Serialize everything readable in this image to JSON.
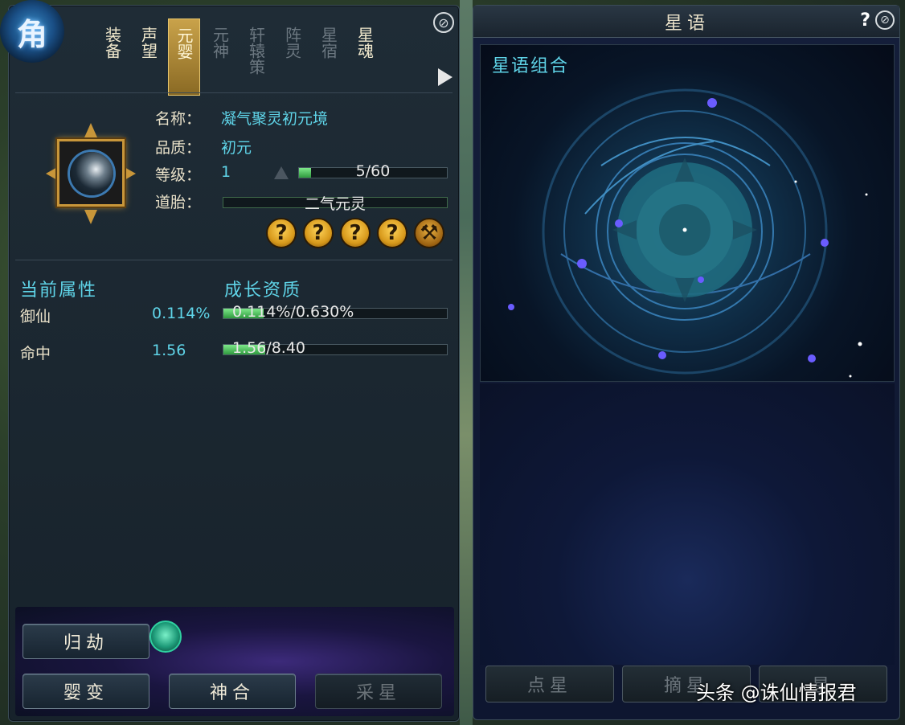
{
  "left_panel": {
    "emblem": "角",
    "tabs": [
      {
        "label": "装备",
        "state": "on"
      },
      {
        "label": "声望",
        "state": "on"
      },
      {
        "label": "元婴",
        "state": "active"
      },
      {
        "label": "元神",
        "state": "dim"
      },
      {
        "label": "轩辕策",
        "state": "dim"
      },
      {
        "label": "阵灵",
        "state": "dim"
      },
      {
        "label": "星宿",
        "state": "dim"
      },
      {
        "label": "星魂",
        "state": "on"
      }
    ],
    "info": {
      "name_label": "名称：",
      "name_value": "凝气聚灵初元境",
      "quality_label": "品质：",
      "quality_value": "初元",
      "level_label": "等级：",
      "level_value": "1",
      "exp_text": "5/60",
      "exp_fraction": 0.083,
      "dao_label": "道胎：",
      "dao_text": "二气元灵",
      "slots": [
        "?",
        "?",
        "?",
        "?",
        ""
      ]
    },
    "current_attrs_title": "当前属性",
    "growth_title": "成长资质",
    "attrs": [
      {
        "name": "御仙",
        "value": "0.114%",
        "growth_text": "0.114%/0.630%",
        "fraction": 0.18
      },
      {
        "name": "命中",
        "value": "1.56",
        "growth_text": "1.56/8.40",
        "fraction": 0.186
      }
    ],
    "buttons": {
      "guijie": "归劫",
      "yingbian": "婴变",
      "shenhe": "神合",
      "caixing": "采星"
    }
  },
  "right_panel": {
    "title": "星语",
    "help": "?",
    "subtitle": "星语组合",
    "buttons": {
      "dianxing": "点星",
      "zhaixing": "摘星",
      "third": "星"
    }
  },
  "watermark": "头条 @诛仙情报君",
  "icons": {
    "close": "close-icon",
    "arrow": "arrow-right-icon",
    "gem": "gem-icon"
  }
}
